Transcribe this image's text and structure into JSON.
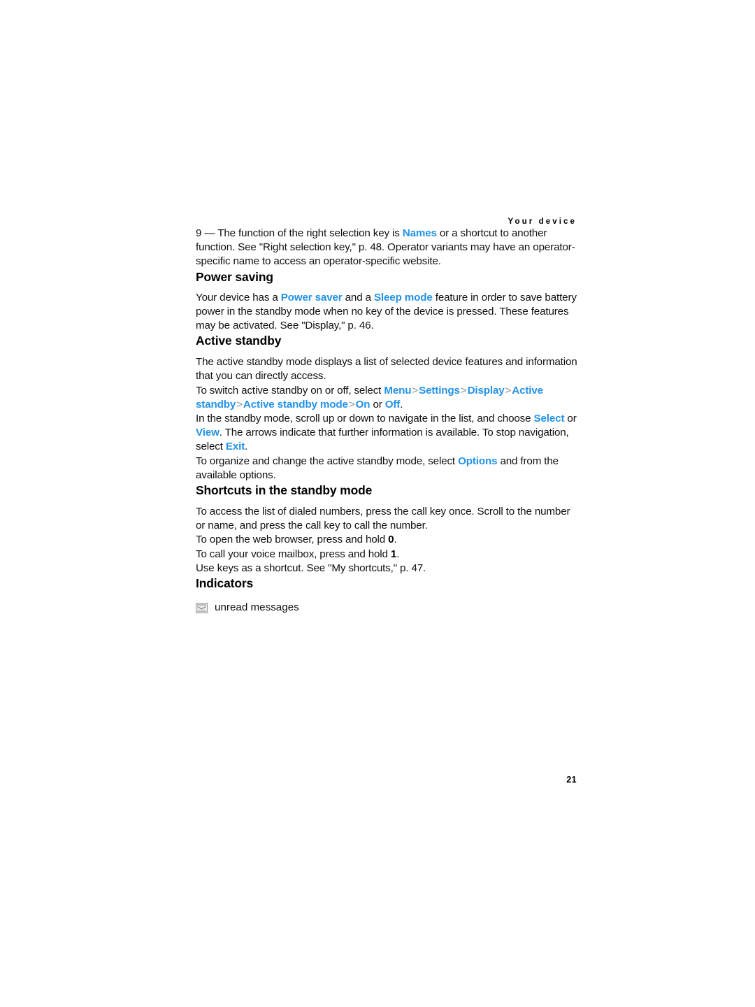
{
  "document": {
    "running_header": "Your device",
    "page_number": "21",
    "accent_color": "#2392E8",
    "separator_color": "#8a8d90"
  },
  "blocks": {
    "intro": {
      "prefix": "9 — The function of the right selection key is ",
      "link": "Names",
      "suffix": " or a shortcut to another function. See \"Right selection key,\" p. 48. Operator variants may have an operator-specific name to access an operator-specific website."
    },
    "power_saving": {
      "heading": "Power saving",
      "p1_a": "Your device has a ",
      "p1_link1": "Power saver",
      "p1_b": " and a ",
      "p1_link2": "Sleep mode",
      "p1_c": " feature in order to save battery power in the standby mode when no key of the device is pressed. These features may be activated. See \"Display,\" p. 46."
    },
    "active_standby": {
      "heading": "Active standby",
      "p1": "The active standby mode displays a list of selected device features and information that you can directly access.",
      "p2_a": "To switch active standby on or off, select ",
      "p2_menu": "Menu",
      "p2_sep1": ">",
      "p2_settings": "Settings",
      "p2_sep2": ">",
      "p2_display": "Display",
      "p2_sep3": ">",
      "p2_active_standby": "Active standby",
      "p2_sep4": ">",
      "p2_active_standby_mode": "Active standby mode",
      "p2_sep5": ">",
      "p2_on": "On",
      "p2_or": " or ",
      "p2_off": "Off",
      "p2_end": ".",
      "p3_a": "In the standby mode, scroll up or down to navigate in the list, and choose ",
      "p3_select": "Select",
      "p3_b": " or ",
      "p3_view": "View",
      "p3_c": ". The arrows indicate that further information is available. To stop navigation, select ",
      "p3_exit": "Exit",
      "p3_d": ".",
      "p4_a": "To organize and change the active standby mode, select ",
      "p4_options": "Options",
      "p4_b": " and from the available options."
    },
    "shortcuts": {
      "heading": "Shortcuts in the standby mode",
      "p1": "To access the list of dialed numbers, press the call key once. Scroll to the number or name, and press the call key to call the number.",
      "p2_a": "To open the web browser, press and hold ",
      "p2_key": "0",
      "p2_b": ".",
      "p3_a": "To call your voice mailbox, press and hold ",
      "p3_key": "1",
      "p3_b": ".",
      "p4": "Use keys as a shortcut. See \"My shortcuts,\" p. 47."
    },
    "indicators": {
      "heading": "Indicators",
      "items": [
        {
          "icon": "unread-message-icon",
          "label": "unread messages"
        }
      ]
    }
  }
}
